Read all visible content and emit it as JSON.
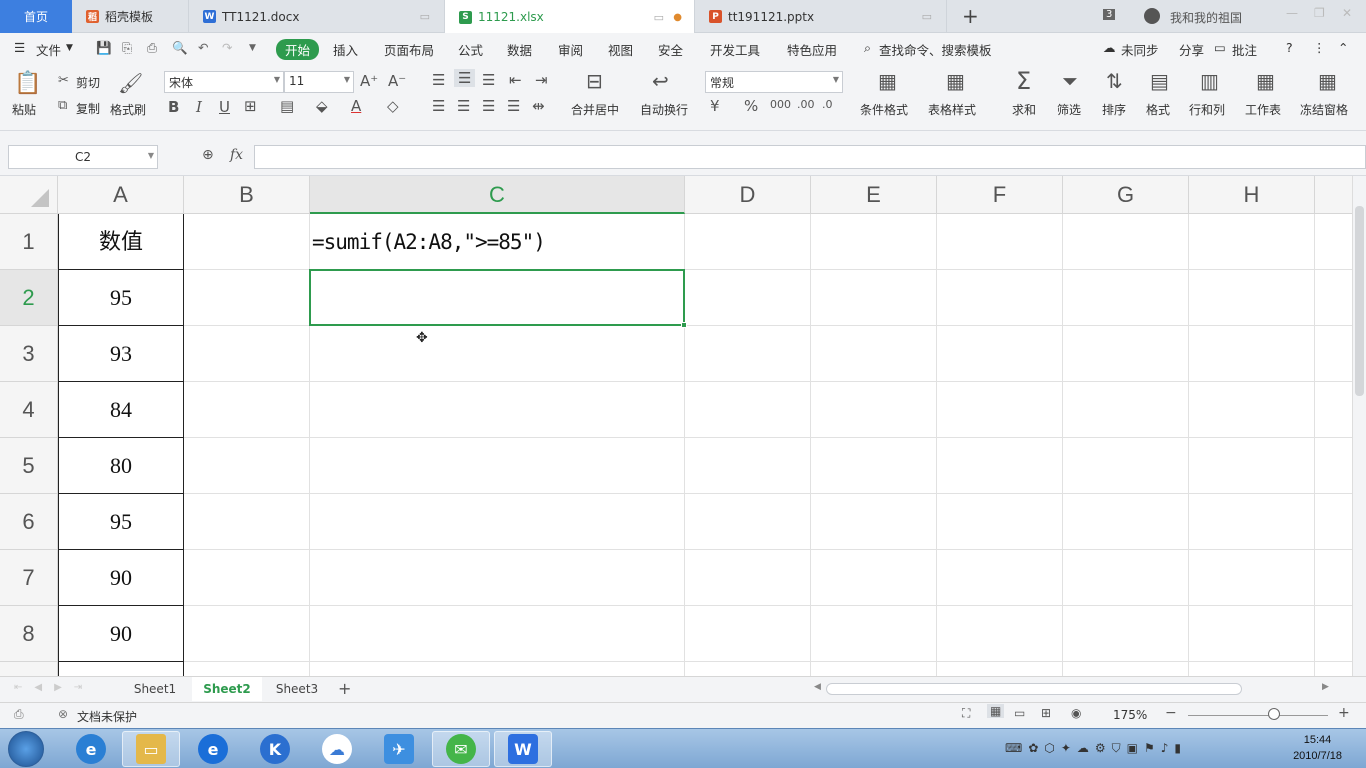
{
  "tabs": {
    "home": "首页",
    "items": [
      {
        "label": "稻壳模板"
      },
      {
        "label": "TT1121.docx"
      },
      {
        "label": "11121.xlsx"
      },
      {
        "label": "tt191121.pptx"
      }
    ],
    "new_tab": "+",
    "count_badge": "3",
    "user_name": "我和我的祖国"
  },
  "menu": {
    "file": "文件",
    "items": [
      "开始",
      "插入",
      "页面布局",
      "公式",
      "数据",
      "审阅",
      "视图",
      "安全",
      "开发工具",
      "特色应用"
    ],
    "search": "查找命令、搜索模板",
    "sync": "未同步",
    "share": "分享",
    "comment": "批注"
  },
  "ribbon": {
    "paste": "粘贴",
    "cut": "剪切",
    "copy": "复制",
    "format_painter": "格式刷",
    "font_name": "宋体",
    "font_size": "11",
    "merge_center": "合并居中",
    "wrap_text": "自动换行",
    "number_format": "常规",
    "conditional_format": "条件格式",
    "table_style": "表格样式",
    "sum": "求和",
    "filter": "筛选",
    "sort": "排序",
    "format": "格式",
    "rows_cols": "行和列",
    "worksheet": "工作表",
    "freeze": "冻结窗格"
  },
  "formula_bar": {
    "name_box": "C2",
    "fx": "fx",
    "content": ""
  },
  "grid": {
    "columns": [
      "A",
      "B",
      "C",
      "D",
      "E",
      "F",
      "G",
      "H"
    ],
    "selected_column": "C",
    "rows": [
      "1",
      "2",
      "3",
      "4",
      "5",
      "6",
      "7",
      "8"
    ],
    "selected_row": "2",
    "column_a": [
      "数值",
      "95",
      "93",
      "84",
      "80",
      "95",
      "90",
      "90"
    ],
    "c1_text": "=sumif(A2:A8,\">=85\")"
  },
  "sheets": {
    "items": [
      "Sheet1",
      "Sheet2",
      "Sheet3"
    ],
    "active": "Sheet2",
    "add": "+"
  },
  "status": {
    "protection": "文档未保护",
    "zoom": "175%"
  },
  "taskbar": {
    "time": "15:44",
    "date": "2010/7/18"
  },
  "colors": {
    "accent_green": "#2e9b4e",
    "home_tab_blue": "#3d7fe0"
  }
}
